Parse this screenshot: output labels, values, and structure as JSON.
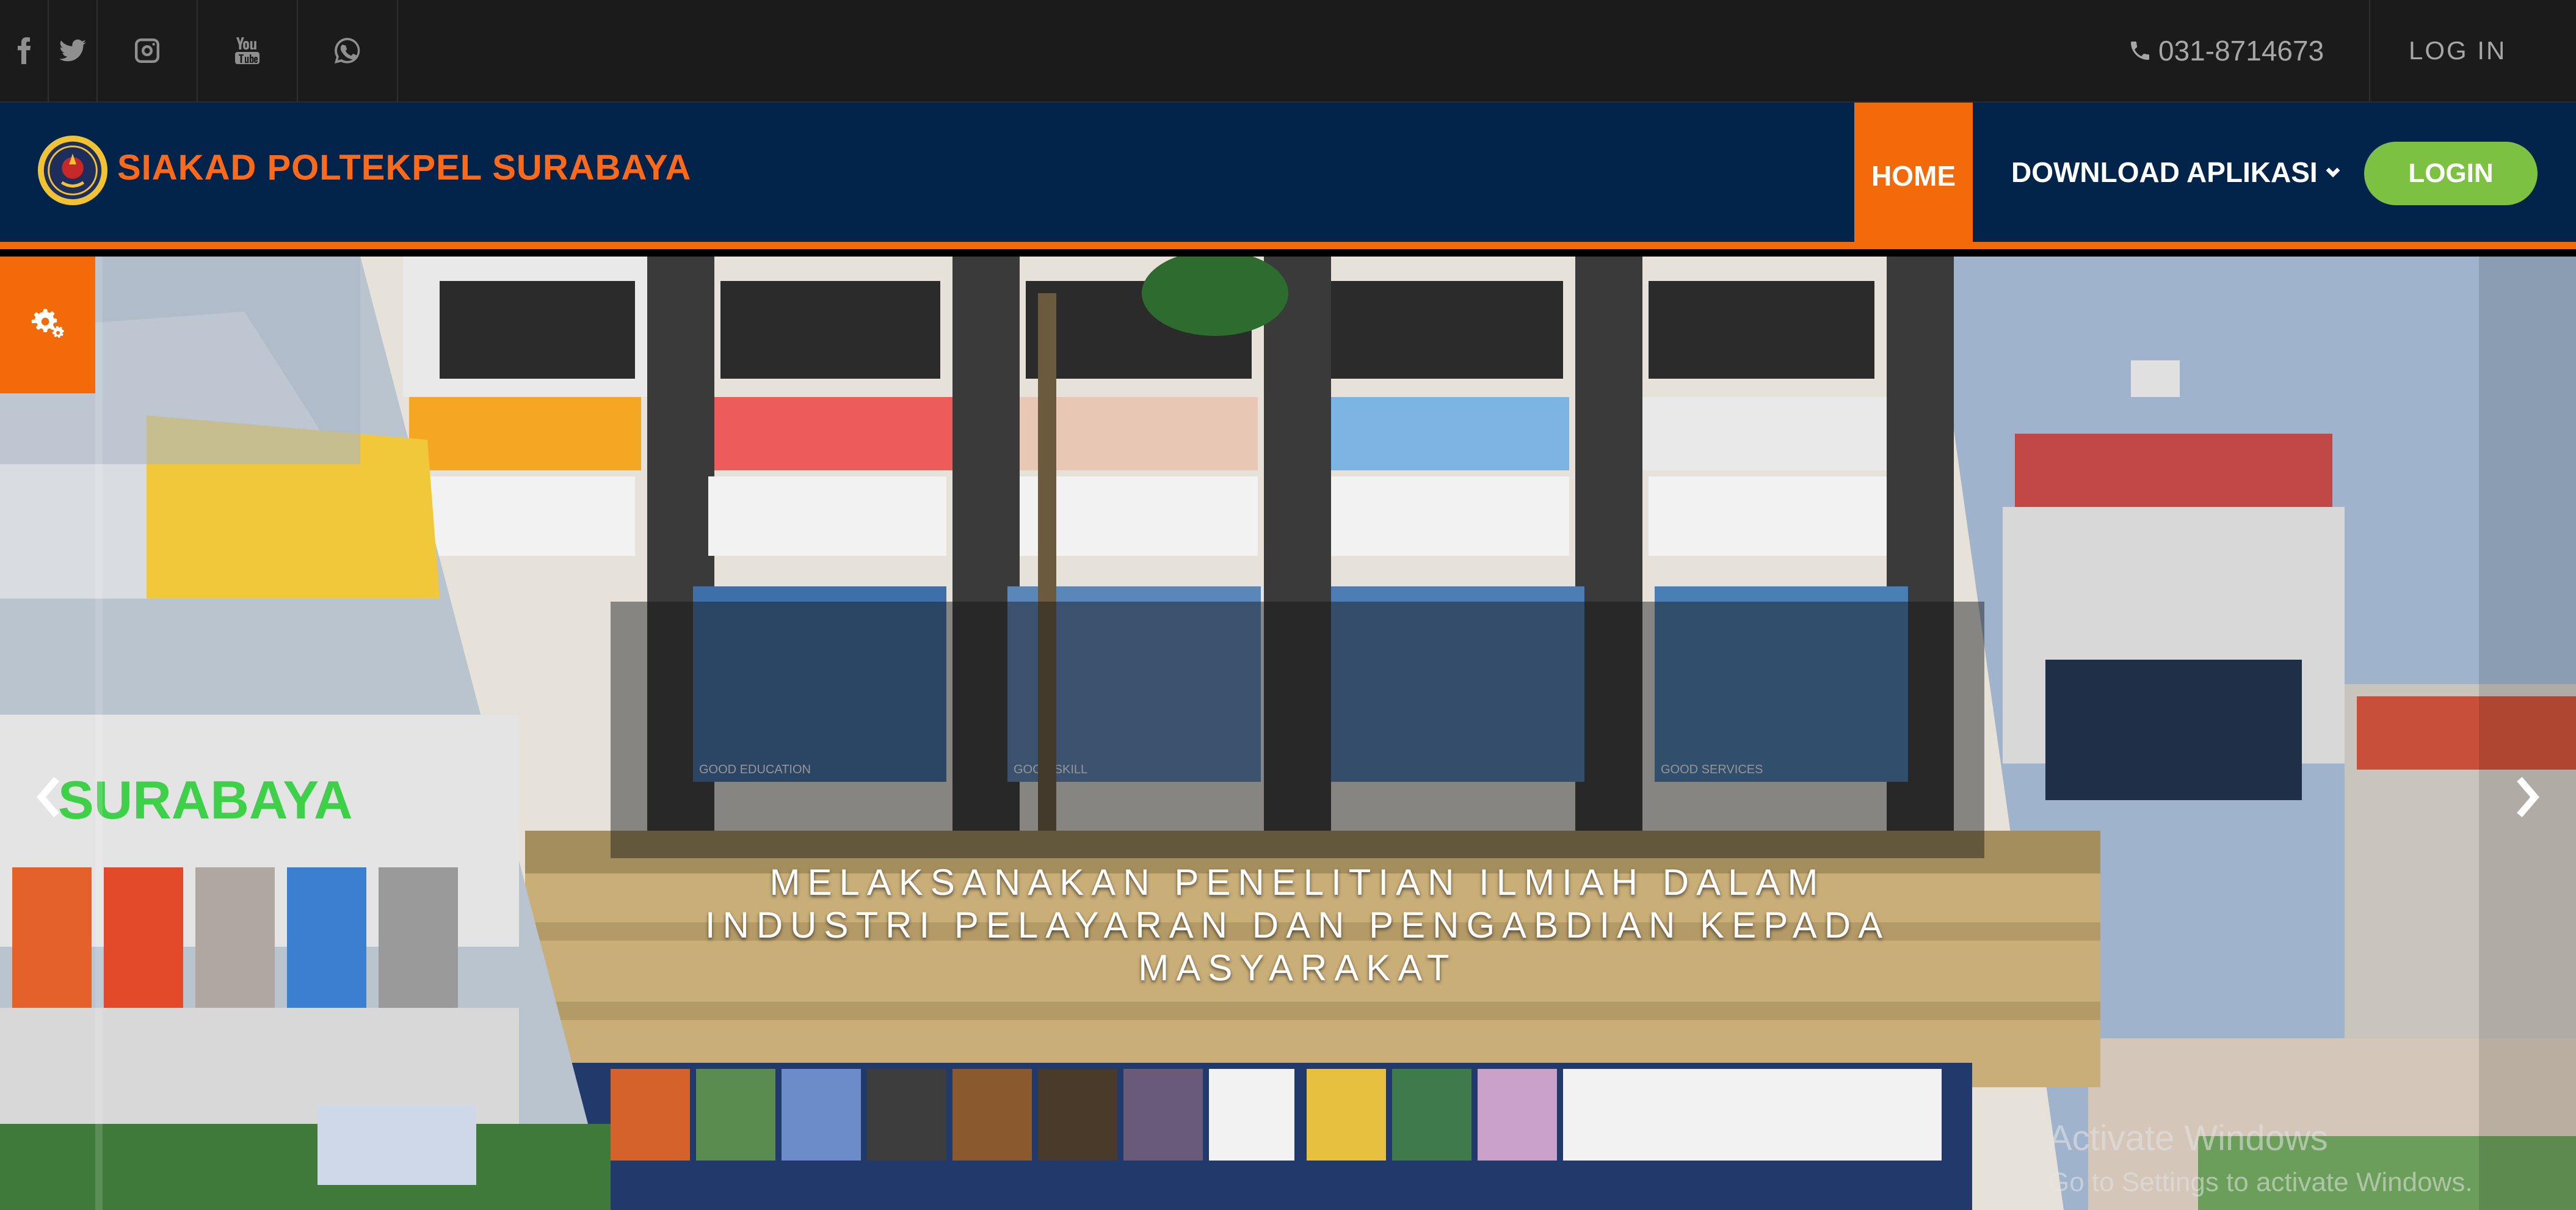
{
  "topbar": {
    "social_icons": [
      "facebook-icon",
      "twitter-icon",
      "instagram-icon",
      "youtube-icon",
      "whatsapp-icon"
    ],
    "phone": "031-8714673",
    "login_link": "LOG IN"
  },
  "navbar": {
    "brand": "SIAKAD POLTEKPEL SURABAYA",
    "items": [
      {
        "label": "HOME",
        "active": true
      },
      {
        "label": "DOWNLOAD APLIKASI",
        "dropdown": true
      }
    ],
    "login_button": "LOGIN"
  },
  "hero": {
    "caption": "MELAKSANAKAN PENELITIAN ILMIAH DALAM INDUSTRI PELAYARAN DAN PENGABDIAN KEPADA MASYARAKAT",
    "sign_text": "SURABAYA",
    "banners": [
      "GOOD EDUCATION",
      "GOOD SKILL",
      "GOOD SERVICES"
    ]
  },
  "watermark": {
    "title": "Activate Windows",
    "subtitle": "Go to Settings to activate Windows."
  },
  "colors": {
    "topbar_bg": "#1b1b1b",
    "navbar_bg": "#03244a",
    "accent_orange": "#f26a0a",
    "login_green": "#7dc142",
    "brand_text": "#ff6a1a"
  }
}
